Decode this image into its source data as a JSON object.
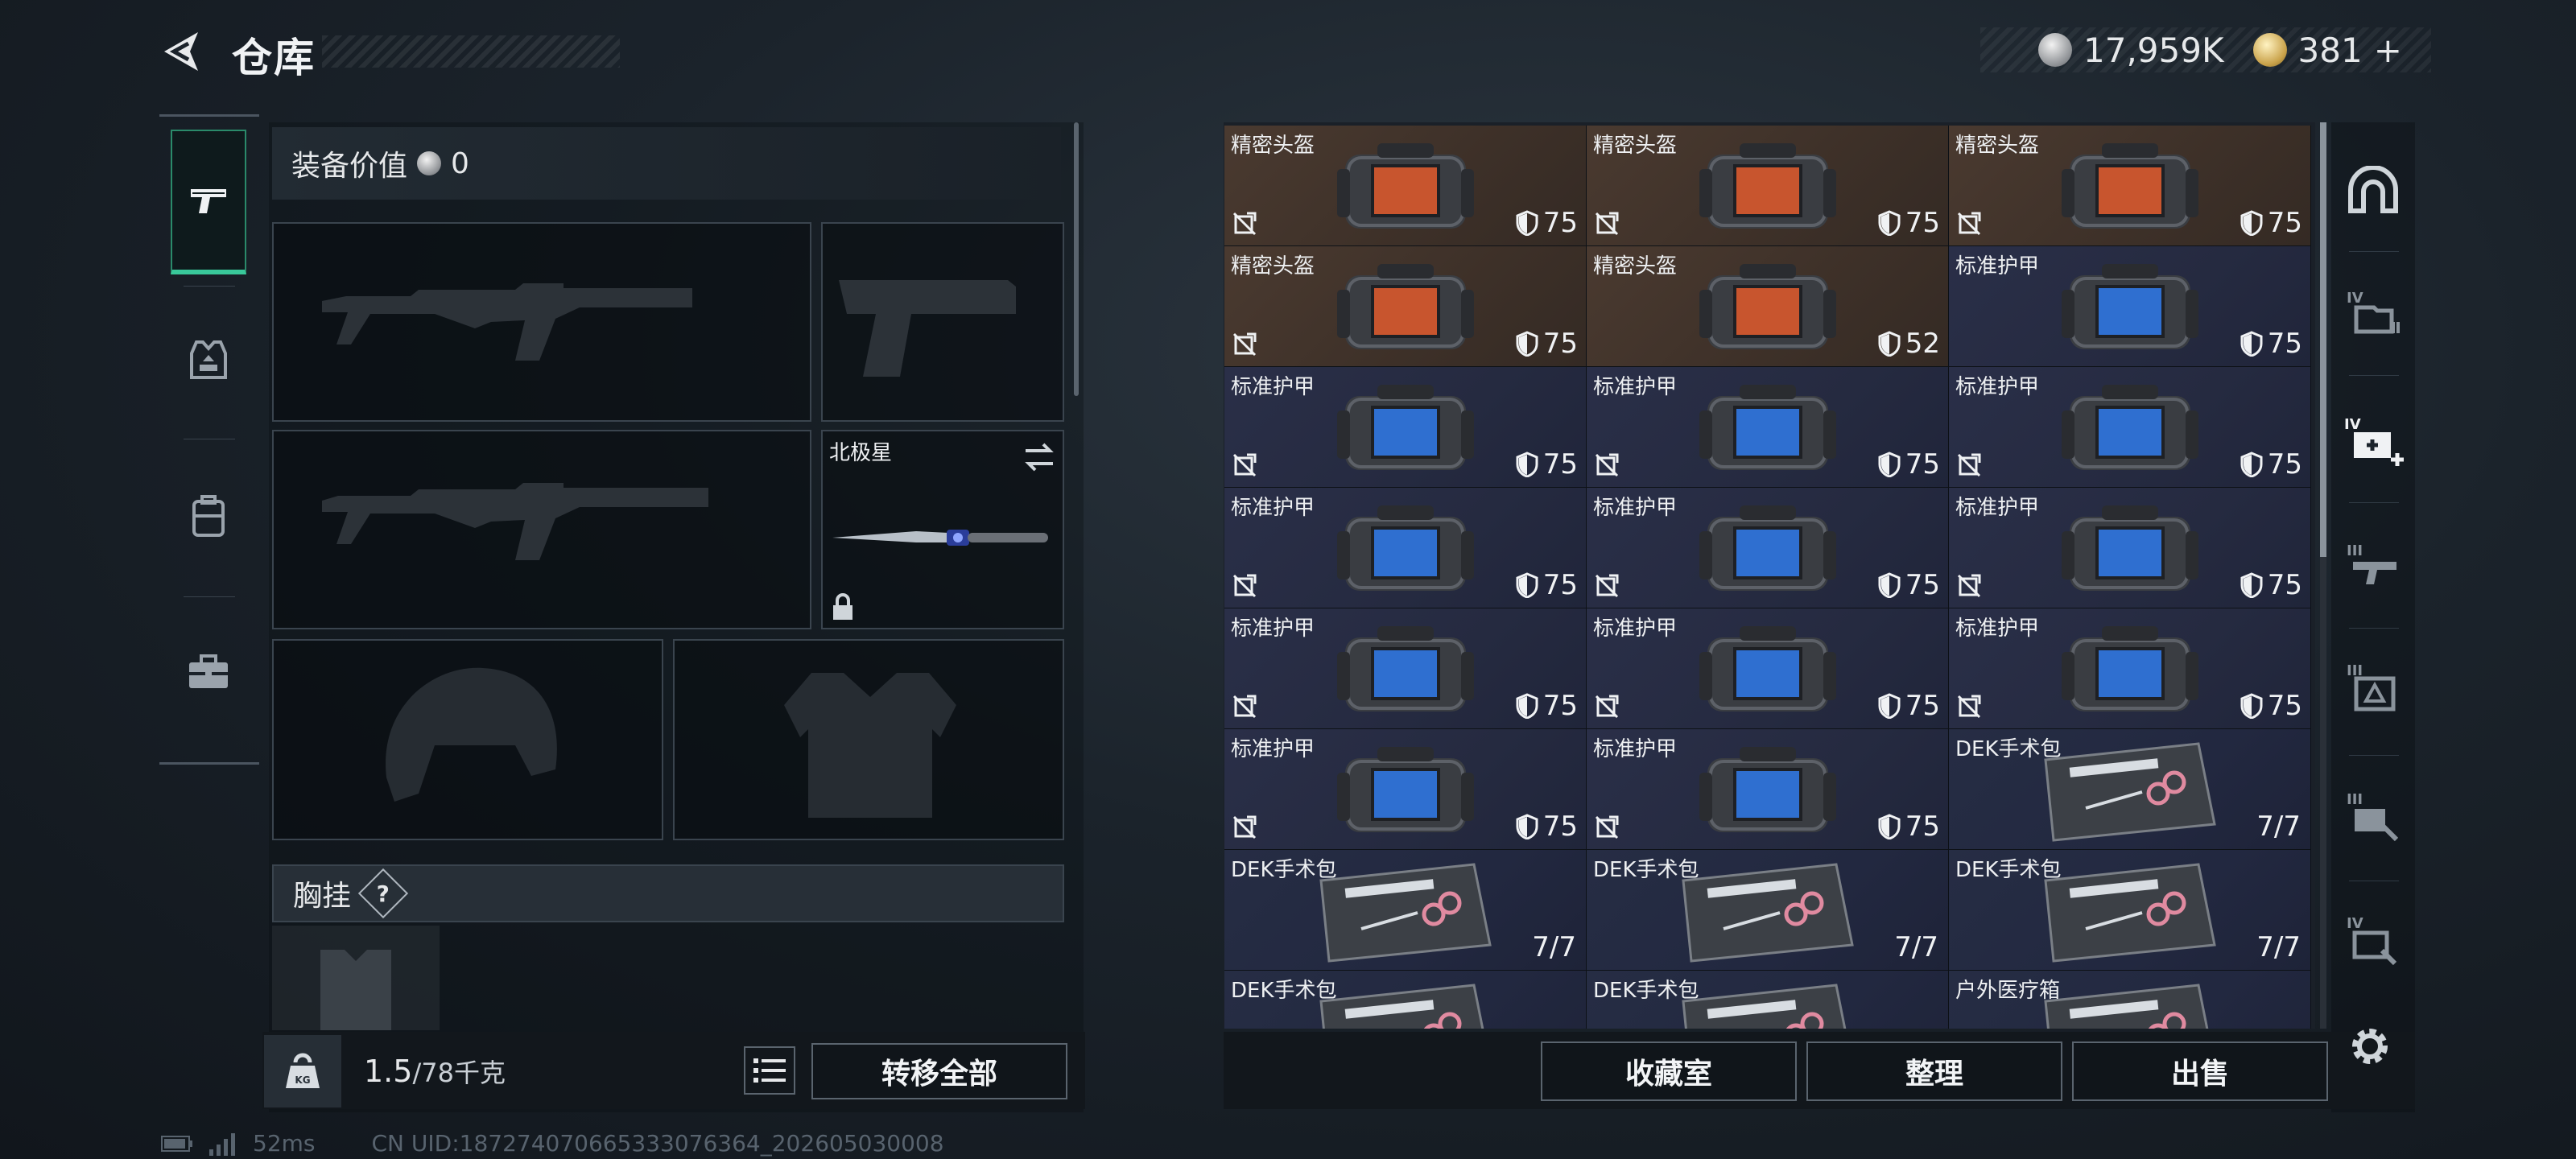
{
  "header": {
    "title": "仓库",
    "currency_silver": "17,959K",
    "currency_gold": "381",
    "currency_gold_plus": "+"
  },
  "loadout": {
    "equip_value_label": "装备价值",
    "equip_value": "0",
    "melee_slot_label": "北极星",
    "chest_rig_label": "胸挂",
    "chest_rig_help": "?"
  },
  "weight": {
    "current": "1.5",
    "max": "/78千克"
  },
  "buttons": {
    "transfer_all": "转移全部",
    "collection_room": "收藏室",
    "organize": "整理",
    "sell": "出售"
  },
  "storage": {
    "items": [
      {
        "name": "精密头盔",
        "kind": "helmet",
        "durability": "75",
        "locked": true
      },
      {
        "name": "精密头盔",
        "kind": "helmet",
        "durability": "75",
        "locked": true
      },
      {
        "name": "精密头盔",
        "kind": "helmet",
        "durability": "75",
        "locked": true
      },
      {
        "name": "精密头盔",
        "kind": "helmet",
        "durability": "75",
        "locked": true
      },
      {
        "name": "精密头盔",
        "kind": "helmet",
        "durability": "52",
        "locked": false
      },
      {
        "name": "标准护甲",
        "kind": "armor",
        "durability": "75",
        "locked": false
      },
      {
        "name": "标准护甲",
        "kind": "armor",
        "durability": "75",
        "locked": true
      },
      {
        "name": "标准护甲",
        "kind": "armor",
        "durability": "75",
        "locked": true
      },
      {
        "name": "标准护甲",
        "kind": "armor",
        "durability": "75",
        "locked": true
      },
      {
        "name": "标准护甲",
        "kind": "armor",
        "durability": "75",
        "locked": true
      },
      {
        "name": "标准护甲",
        "kind": "armor",
        "durability": "75",
        "locked": true
      },
      {
        "name": "标准护甲",
        "kind": "armor",
        "durability": "75",
        "locked": true
      },
      {
        "name": "标准护甲",
        "kind": "armor",
        "durability": "75",
        "locked": true
      },
      {
        "name": "标准护甲",
        "kind": "armor",
        "durability": "75",
        "locked": true
      },
      {
        "name": "标准护甲",
        "kind": "armor",
        "durability": "75",
        "locked": true
      },
      {
        "name": "标准护甲",
        "kind": "armor",
        "durability": "75",
        "locked": true
      },
      {
        "name": "标准护甲",
        "kind": "armor",
        "durability": "75",
        "locked": true
      },
      {
        "name": "DEK手术包",
        "kind": "med",
        "stack": "7/7",
        "locked": false
      },
      {
        "name": "DEK手术包",
        "kind": "med",
        "stack": "7/7",
        "locked": false
      },
      {
        "name": "DEK手术包",
        "kind": "med",
        "stack": "7/7",
        "locked": false
      },
      {
        "name": "DEK手术包",
        "kind": "med",
        "stack": "7/7",
        "locked": false
      },
      {
        "name": "DEK手术包",
        "kind": "med",
        "stack": "",
        "locked": false
      },
      {
        "name": "DEK手术包",
        "kind": "med",
        "stack": "",
        "locked": false
      },
      {
        "name": "户外医疗箱",
        "kind": "med",
        "stack": "",
        "locked": false
      }
    ]
  },
  "right_rail": {
    "labels": [
      "IV",
      "IV",
      "III",
      "III",
      "III",
      "IV"
    ]
  },
  "status": {
    "ping": "52ms",
    "uid": "CN UID:18727407066533307636​4_202605030008"
  },
  "colors": {
    "accent_green": "#39c89a",
    "helmet_bg": "#4a3a30",
    "armor_bg": "#2a2f48"
  }
}
